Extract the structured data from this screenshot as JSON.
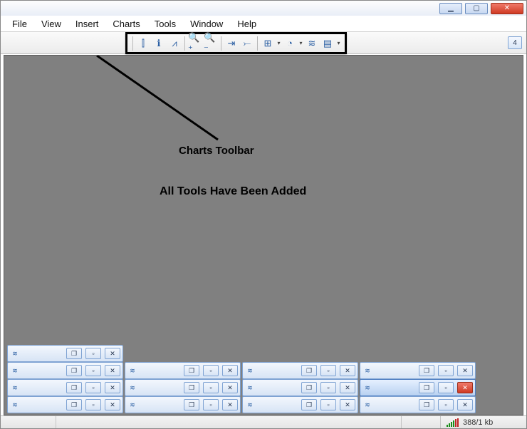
{
  "titlebar": {
    "minimize_glyph": "▁",
    "maximize_glyph": "▢",
    "close_glyph": "✕"
  },
  "menu": {
    "items": [
      "File",
      "View",
      "Insert",
      "Charts",
      "Tools",
      "Window",
      "Help"
    ]
  },
  "toolbar_side": {
    "badge": "4"
  },
  "charts_toolbar": {
    "items": [
      {
        "name": "bar-chart-icon",
        "glyph": "⫿",
        "sep_after": false
      },
      {
        "name": "candlestick-icon",
        "glyph": "ℹ",
        "sep_after": false
      },
      {
        "name": "line-chart-icon",
        "glyph": "⩘",
        "sep_after": true
      },
      {
        "name": "zoom-in-icon",
        "glyph": "🔍⁺",
        "sep_after": false
      },
      {
        "name": "zoom-out-icon",
        "glyph": "🔍⁻",
        "sep_after": true
      },
      {
        "name": "auto-scroll-icon",
        "glyph": "⇥",
        "sep_after": false
      },
      {
        "name": "chart-shift-icon",
        "glyph": "⤚",
        "sep_after": true
      },
      {
        "name": "indicators-icon",
        "glyph": "⊞",
        "sep_after": false,
        "has_dropdown": true
      },
      {
        "name": "periodicity-icon",
        "glyph": "◔",
        "sep_after": false,
        "has_dropdown": true
      },
      {
        "name": "templates-icon",
        "glyph": "≋",
        "sep_after": false
      },
      {
        "name": "tile-icon",
        "glyph": "▤",
        "sep_after": false,
        "has_dropdown": true
      }
    ]
  },
  "annotations": {
    "label1": "Charts Toolbar",
    "label2": "All Tools Have Been Added"
  },
  "child_window": {
    "icon_glyph": "≋",
    "btn_min": "▁",
    "btn_restore": "❐",
    "btn_max": "▫",
    "btn_close": "✕"
  },
  "statusbar": {
    "net_label": "388/1 kb"
  }
}
